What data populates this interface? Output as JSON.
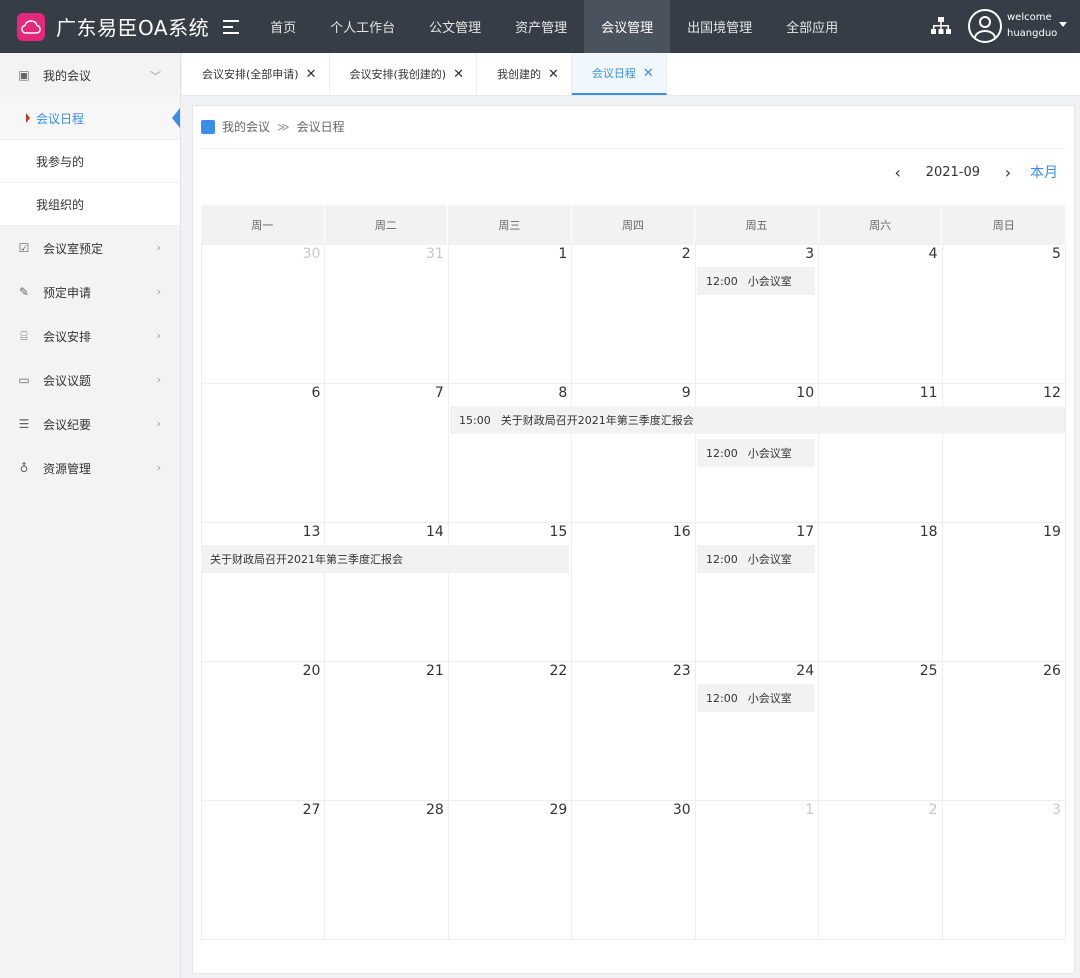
{
  "app": {
    "title": "广东易臣OA系统"
  },
  "nav": [
    "首页",
    "个人工作台",
    "公文管理",
    "资产管理",
    "会议管理",
    "出国境管理",
    "全部应用"
  ],
  "user": {
    "welcome": "welcome",
    "name": "huangduo"
  },
  "sidebar": {
    "groups": [
      {
        "label": "我的会议",
        "icon": "monitor-icon"
      },
      {
        "label": "会议室预定",
        "icon": "checkbox-icon"
      },
      {
        "label": "预定申请",
        "icon": "edit-icon"
      },
      {
        "label": "会议安排",
        "icon": "sofa-icon"
      },
      {
        "label": "会议议题",
        "icon": "chat-icon"
      },
      {
        "label": "会议纪要",
        "icon": "document-icon"
      },
      {
        "label": "资源管理",
        "icon": "pin-icon"
      }
    ],
    "sub_items": [
      "会议日程",
      "我参与的",
      "我组织的"
    ]
  },
  "tabs": [
    "会议安排(全部申请)",
    "会议安排(我创建的)",
    "我创建的",
    "会议日程"
  ],
  "breadcrumb": {
    "root": "我的会议",
    "current": "会议日程"
  },
  "calendar": {
    "month_label": "2021-09",
    "today_label": "本月",
    "weekdays": [
      "周一",
      "周二",
      "周三",
      "周四",
      "周五",
      "周六",
      "周日"
    ],
    "weeks": [
      [
        {
          "d": "30",
          "m": true
        },
        {
          "d": "31",
          "m": true
        },
        {
          "d": "1"
        },
        {
          "d": "2"
        },
        {
          "d": "3"
        },
        {
          "d": "4"
        },
        {
          "d": "5"
        }
      ],
      [
        {
          "d": "6"
        },
        {
          "d": "7"
        },
        {
          "d": "8"
        },
        {
          "d": "9"
        },
        {
          "d": "10"
        },
        {
          "d": "11"
        },
        {
          "d": "12"
        }
      ],
      [
        {
          "d": "13"
        },
        {
          "d": "14"
        },
        {
          "d": "15"
        },
        {
          "d": "16"
        },
        {
          "d": "17"
        },
        {
          "d": "18"
        },
        {
          "d": "19"
        }
      ],
      [
        {
          "d": "20"
        },
        {
          "d": "21"
        },
        {
          "d": "22"
        },
        {
          "d": "23"
        },
        {
          "d": "24"
        },
        {
          "d": "25"
        },
        {
          "d": "26"
        }
      ],
      [
        {
          "d": "27"
        },
        {
          "d": "28"
        },
        {
          "d": "29"
        },
        {
          "d": "30"
        },
        {
          "d": "1",
          "m": true
        },
        {
          "d": "2",
          "m": true
        },
        {
          "d": "3",
          "m": true
        }
      ]
    ],
    "events": {
      "small_room": {
        "time": "12:00",
        "title": "小会议室"
      },
      "report": {
        "time": "15:00",
        "title": "关于财政局召开2021年第三季度汇报会"
      }
    }
  }
}
